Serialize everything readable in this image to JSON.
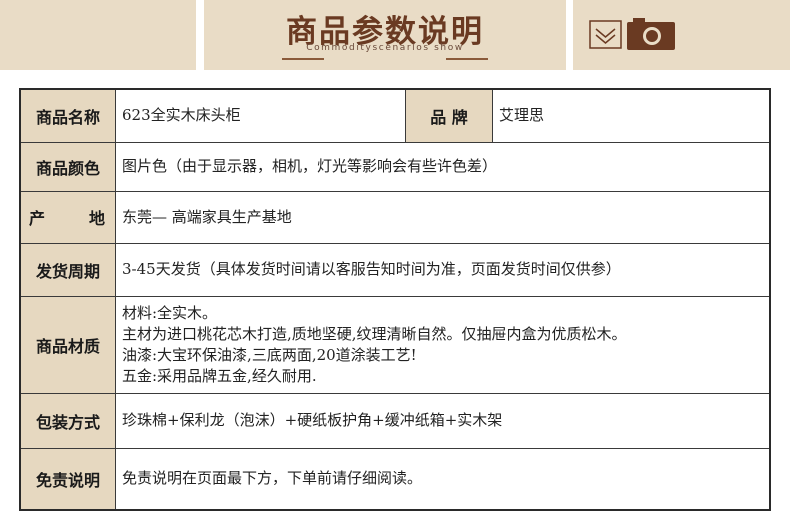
{
  "header": {
    "title": "商品参数说明",
    "subtitle": "Commodityscenarios show",
    "icons": [
      "envelope-icon",
      "camera-icon"
    ]
  },
  "colors": {
    "band": "#e9dcc6",
    "label_bg": "#e6d8c0",
    "title": "#6a3a22",
    "border": "#2a2a2a"
  },
  "spec": {
    "name_label": "商品名称",
    "name_value": "623全实木床头柜",
    "brand_label": "品 牌",
    "brand_value": "艾理思",
    "color_label": "商品颜色",
    "color_value": "图片色（由于显示器，相机，灯光等影响会有些许色差）",
    "origin_label": "产 地",
    "origin_value": "东莞— 高端家具生产基地",
    "delivery_label": "发货周期",
    "delivery_value": "3-45天发货（具体发货时间请以客服告知时间为准，页面发货时间仅供参）",
    "material_label": "商品材质",
    "material_lines": [
      "材料:全实木。",
      "主材为进口桃花芯木打造,质地坚硬,纹理清晰自然。仅抽屉内盒为优质松木。",
      "油漆:大宝环保油漆,三底两面,20道涂装工艺!",
      "五金:采用品牌五金,经久耐用."
    ],
    "packing_label": "包装方式",
    "packing_value": "珍珠棉+保利龙（泡沫）+硬纸板护角+缓冲纸箱+实木架",
    "disclaimer_label": "免责说明",
    "disclaimer_value": "免责说明在页面最下方，下单前请仔细阅读。"
  }
}
